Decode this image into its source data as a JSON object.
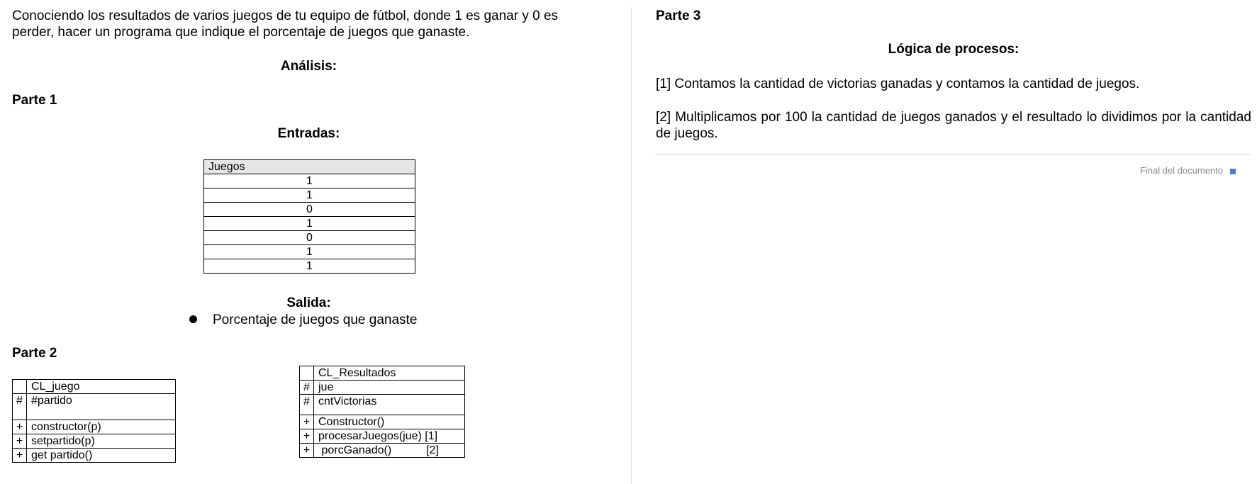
{
  "left": {
    "intro": "Conociendo los resultados de varios juegos de tu equipo de fútbol, donde 1 es ganar y 0 es perder, hacer un programa que indique el porcentaje de juegos que ganaste.",
    "analisis_heading": "Análisis:",
    "parte1_heading": "Parte 1",
    "entradas_heading": "Entradas:",
    "juegos_table": {
      "header": "Juegos",
      "rows": [
        "1",
        "1",
        "0",
        "1",
        "0",
        "1",
        "1"
      ]
    },
    "salida_heading": "Salida:",
    "salida_item": "Porcentaje de juegos que ganaste",
    "parte2_heading": "Parte 2",
    "class_juego": {
      "name": "CL_juego",
      "attributes": [
        {
          "sym": "#",
          "text": "#partido"
        }
      ],
      "methods": [
        {
          "sym": "+",
          "text": "constructor(p)"
        },
        {
          "sym": "+",
          "text": "setpartido(p)"
        },
        {
          "sym": "+",
          "text": "get partido()"
        }
      ]
    },
    "class_resultados": {
      "name": "CL_Resultados",
      "attributes": [
        {
          "sym": "#",
          "text": "jue"
        },
        {
          "sym": "#",
          "text": "cntVictorias"
        }
      ],
      "methods": [
        {
          "sym": "+",
          "text": "Constructor()"
        },
        {
          "sym": "+",
          "text": "procesarJuegos(jue) [1]"
        },
        {
          "sym": "+",
          "text": " porcGanado()           [2]"
        }
      ]
    }
  },
  "right": {
    "parte3_heading": "Parte 3",
    "logica_heading": "Lógica de procesos:",
    "step1": "[1] Contamos la cantidad de victorias ganadas y contamos la cantidad de juegos.",
    "step2": "[2] Multiplicamos por 100 la cantidad de juegos ganados y el resultado lo dividimos por la cantidad de juegos.",
    "end_of_document": "Final del documento"
  }
}
